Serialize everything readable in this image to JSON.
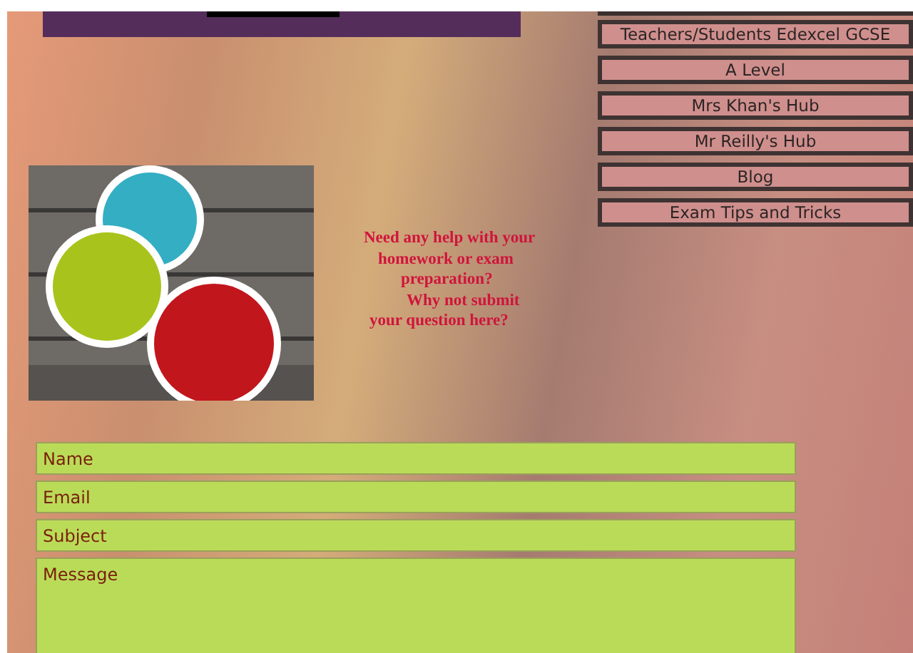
{
  "nav": [
    {
      "label": "Teachers/Students Edexcel GCSE"
    },
    {
      "label": "A Level"
    },
    {
      "label": "Mrs Khan's Hub"
    },
    {
      "label": "Mr Reilly's Hub"
    },
    {
      "label": "Blog"
    },
    {
      "label": "Exam Tips and Tricks"
    }
  ],
  "prompt": {
    "lines": [
      "Need any help with your",
      "homework or exam",
      "preparation?",
      "Why not submit",
      "your question here?"
    ]
  },
  "form": {
    "fields": [
      {
        "placeholder": "Name",
        "kind": "line"
      },
      {
        "placeholder": "Email",
        "kind": "line"
      },
      {
        "placeholder": "Subject",
        "kind": "line"
      },
      {
        "placeholder": "Message",
        "kind": "area"
      }
    ]
  }
}
